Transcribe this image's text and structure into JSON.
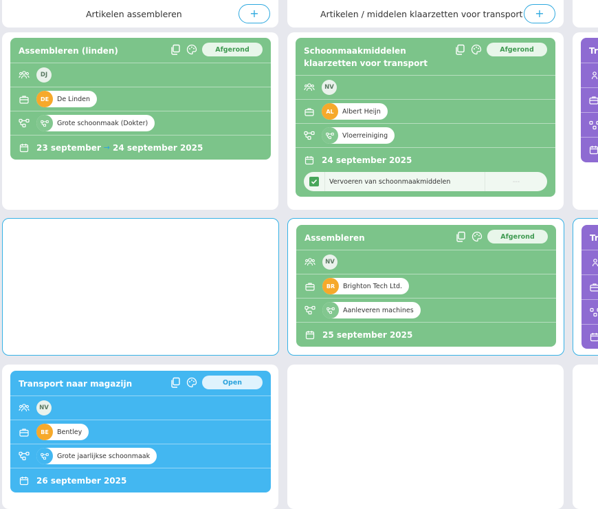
{
  "columns": [
    {
      "title": "Artikelen assembleren",
      "add": "+"
    },
    {
      "title": "Artikelen / middelen klaarzetten voor transport",
      "add": "+"
    }
  ],
  "cards": {
    "c1": {
      "title": "Assembleren (linden)",
      "status": "Afgerond",
      "team": "DJ",
      "client_initials": "DE",
      "client": "De Linden",
      "process": "Grote schoonmaak (Dokter)",
      "date_from": "23 september",
      "arrow": "→",
      "date_to": "24 september 2025"
    },
    "c2": {
      "title": "Schoonmaakmiddelen klaarzetten voor transport",
      "status": "Afgerond",
      "team": "NV",
      "client_initials": "AL",
      "client": "Albert Heijn",
      "process": "Vloerreiniging",
      "date": "24 september 2025",
      "task": "Vervoeren van schoonmaakmiddelen",
      "task_extra": "---"
    },
    "c3": {
      "title": "Assembleren",
      "status": "Afgerond",
      "team": "NV",
      "client_initials": "BR",
      "client": "Brighton Tech Ltd.",
      "process": "Aanleveren machines",
      "date": "25 september 2025"
    },
    "c4": {
      "title": "Transport naar magazijn",
      "status": "Open",
      "team": "NV",
      "client_initials": "BE",
      "client": "Bentley",
      "process": "Grote jaarlijkse schoonmaak",
      "date": "26 september 2025"
    },
    "c5": {
      "title_part": "Tr"
    },
    "c6": {
      "title_part": "Tr"
    }
  },
  "colors": {
    "green": "#7cc48a",
    "blue": "#43b7f1",
    "purple": "#8e6bd2",
    "accent": "#2da8df"
  }
}
